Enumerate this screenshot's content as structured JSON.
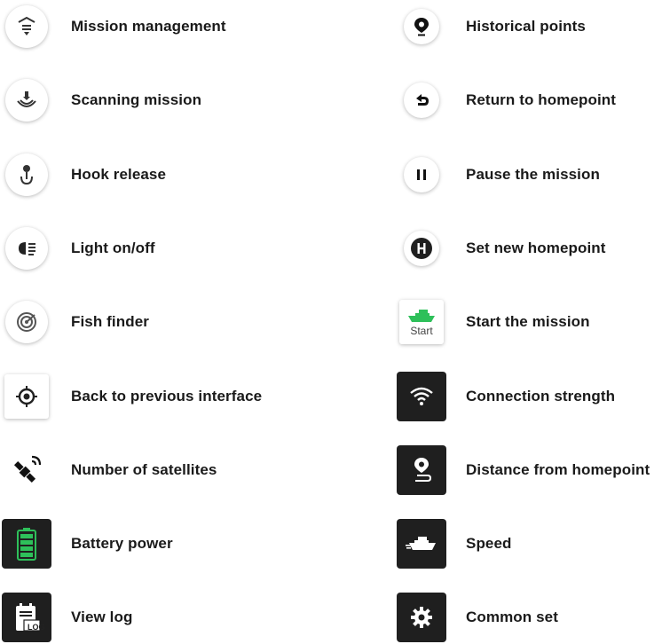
{
  "left_column": [
    {
      "label": "Mission management",
      "icon": "mission-management-icon"
    },
    {
      "label": "Scanning mission",
      "icon": "scanning-mission-icon"
    },
    {
      "label": "Hook release",
      "icon": "hook-release-icon"
    },
    {
      "label": "Light on/off",
      "icon": "light-icon"
    },
    {
      "label": "Fish finder",
      "icon": "fish-finder-icon"
    },
    {
      "label": "Back to previous interface",
      "icon": "locate-target-icon"
    },
    {
      "label": "Number of satellites",
      "icon": "satellite-icon"
    },
    {
      "label": "Battery power",
      "icon": "battery-icon"
    },
    {
      "label": "View log",
      "icon": "log-icon"
    }
  ],
  "right_column": [
    {
      "label": "Historical points",
      "icon": "map-pin-icon"
    },
    {
      "label": "Return to homepoint",
      "icon": "return-arrow-icon"
    },
    {
      "label": "Pause the mission",
      "icon": "pause-icon"
    },
    {
      "label": "Set new homepoint",
      "icon": "home-h-icon"
    },
    {
      "label": "Start the mission",
      "icon": "start-boat-icon",
      "icon_text": "Start"
    },
    {
      "label": "Connection strength",
      "icon": "wifi-icon"
    },
    {
      "label": "Distance from homepoint",
      "icon": "distance-pin-icon"
    },
    {
      "label": "Speed",
      "icon": "speed-boat-icon"
    },
    {
      "label": "Common set",
      "icon": "gear-icon"
    }
  ],
  "log_icon_text": "LOG",
  "colors": {
    "accent_green": "#2ec05a",
    "dark_tile": "#1f1f1f",
    "text": "#1a1a1a"
  }
}
